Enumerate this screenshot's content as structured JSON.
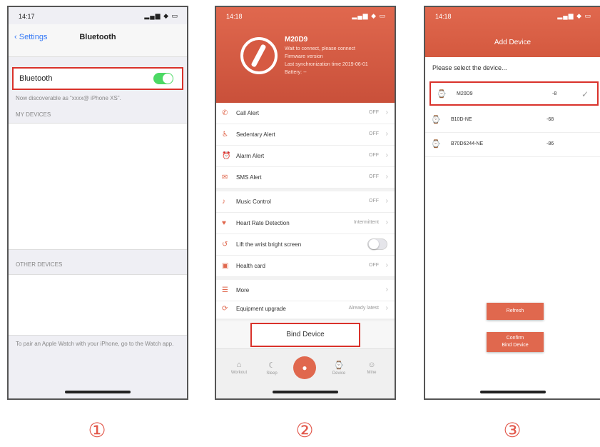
{
  "colors": {
    "accent": "#e0684e",
    "highlight": "#d9322b",
    "toggle_on": "#4cd964",
    "ios_blue": "#3478f6",
    "step_numbers": "#e2574a"
  },
  "panel1": {
    "status": {
      "time": "14:17",
      "icons": "▂▄▆ ◆ ▭"
    },
    "nav": {
      "back": "Settings",
      "title": "Bluetooth"
    },
    "bluetooth_row": {
      "label": "Bluetooth",
      "toggle_on": true
    },
    "captions": [
      "Now discoverable as “xxxx@ iPhone XS”.",
      "MY DEVICES",
      "OTHER DEVICES",
      "To pair an Apple Watch with your iPhone, go to the Watch app."
    ]
  },
  "panel2": {
    "status": {
      "time": "14:18",
      "icons": "▂▄▆ ◆ ▭"
    },
    "device": {
      "name": "M20D9",
      "lines": [
        "Wait to connect, please connect",
        "Firmware version",
        "Last synchronization time 2019-06-01",
        "Battery: --"
      ]
    },
    "rows_a": [
      {
        "icon": "phone-icon",
        "glyph": "✆",
        "label": "Call Alert",
        "value": "OFF"
      },
      {
        "icon": "sedentary-icon",
        "glyph": "♿",
        "label": "Sedentary Alert",
        "value": "OFF"
      },
      {
        "icon": "alarm-icon",
        "glyph": "⏰",
        "label": "Alarm Alert",
        "value": "OFF"
      },
      {
        "icon": "sms-icon",
        "glyph": "✉",
        "label": "SMS Alert",
        "value": "OFF"
      }
    ],
    "rows_b": [
      {
        "icon": "music-icon",
        "glyph": "♪",
        "label": "Music Control",
        "value": "OFF",
        "toggle": false
      },
      {
        "icon": "heart-rate-icon",
        "glyph": "♥",
        "label": "Heart Rate Detection",
        "value": "Intermittent",
        "toggle": false
      },
      {
        "icon": "wrist-icon",
        "glyph": "↺",
        "label": "Lift the wrist bright screen",
        "value": "",
        "toggle": true
      },
      {
        "icon": "health-card-icon",
        "glyph": "▣",
        "label": "Health card",
        "value": "OFF",
        "toggle": false
      }
    ],
    "rows_c": [
      {
        "icon": "more-icon",
        "glyph": "☰",
        "label": "More",
        "value": ""
      },
      {
        "icon": "upgrade-icon",
        "glyph": "⟳",
        "label": "Equipment upgrade",
        "value": "Already latest"
      }
    ],
    "bind_button": "Bind Device",
    "tabs": [
      {
        "icon": "home-tab-icon",
        "glyph": "⌂",
        "label": "Workout"
      },
      {
        "icon": "sleep-tab-icon",
        "glyph": "☾",
        "label": "Sleep"
      },
      {
        "icon": "device-tab-icon",
        "glyph": "⌚",
        "label": "Device"
      },
      {
        "icon": "me-tab-icon",
        "glyph": "☺",
        "label": "Mine"
      }
    ]
  },
  "panel3": {
    "status": {
      "time": "14:18",
      "icons": "▂▄▆ ◆ ▭"
    },
    "title": "Add Device",
    "prompt": "Please select the device...",
    "devices": [
      {
        "name": "M20D9",
        "rssi": "-8",
        "selected": true
      },
      {
        "name": "B10D-NE",
        "rssi": "-68",
        "selected": false
      },
      {
        "name": "B70D6244-NE",
        "rssi": "-86",
        "selected": false
      }
    ],
    "refresh": "Refresh",
    "confirm_line1": "Confirm",
    "confirm_line2": "Bind Device"
  },
  "steps": [
    "①",
    "②",
    "③"
  ]
}
